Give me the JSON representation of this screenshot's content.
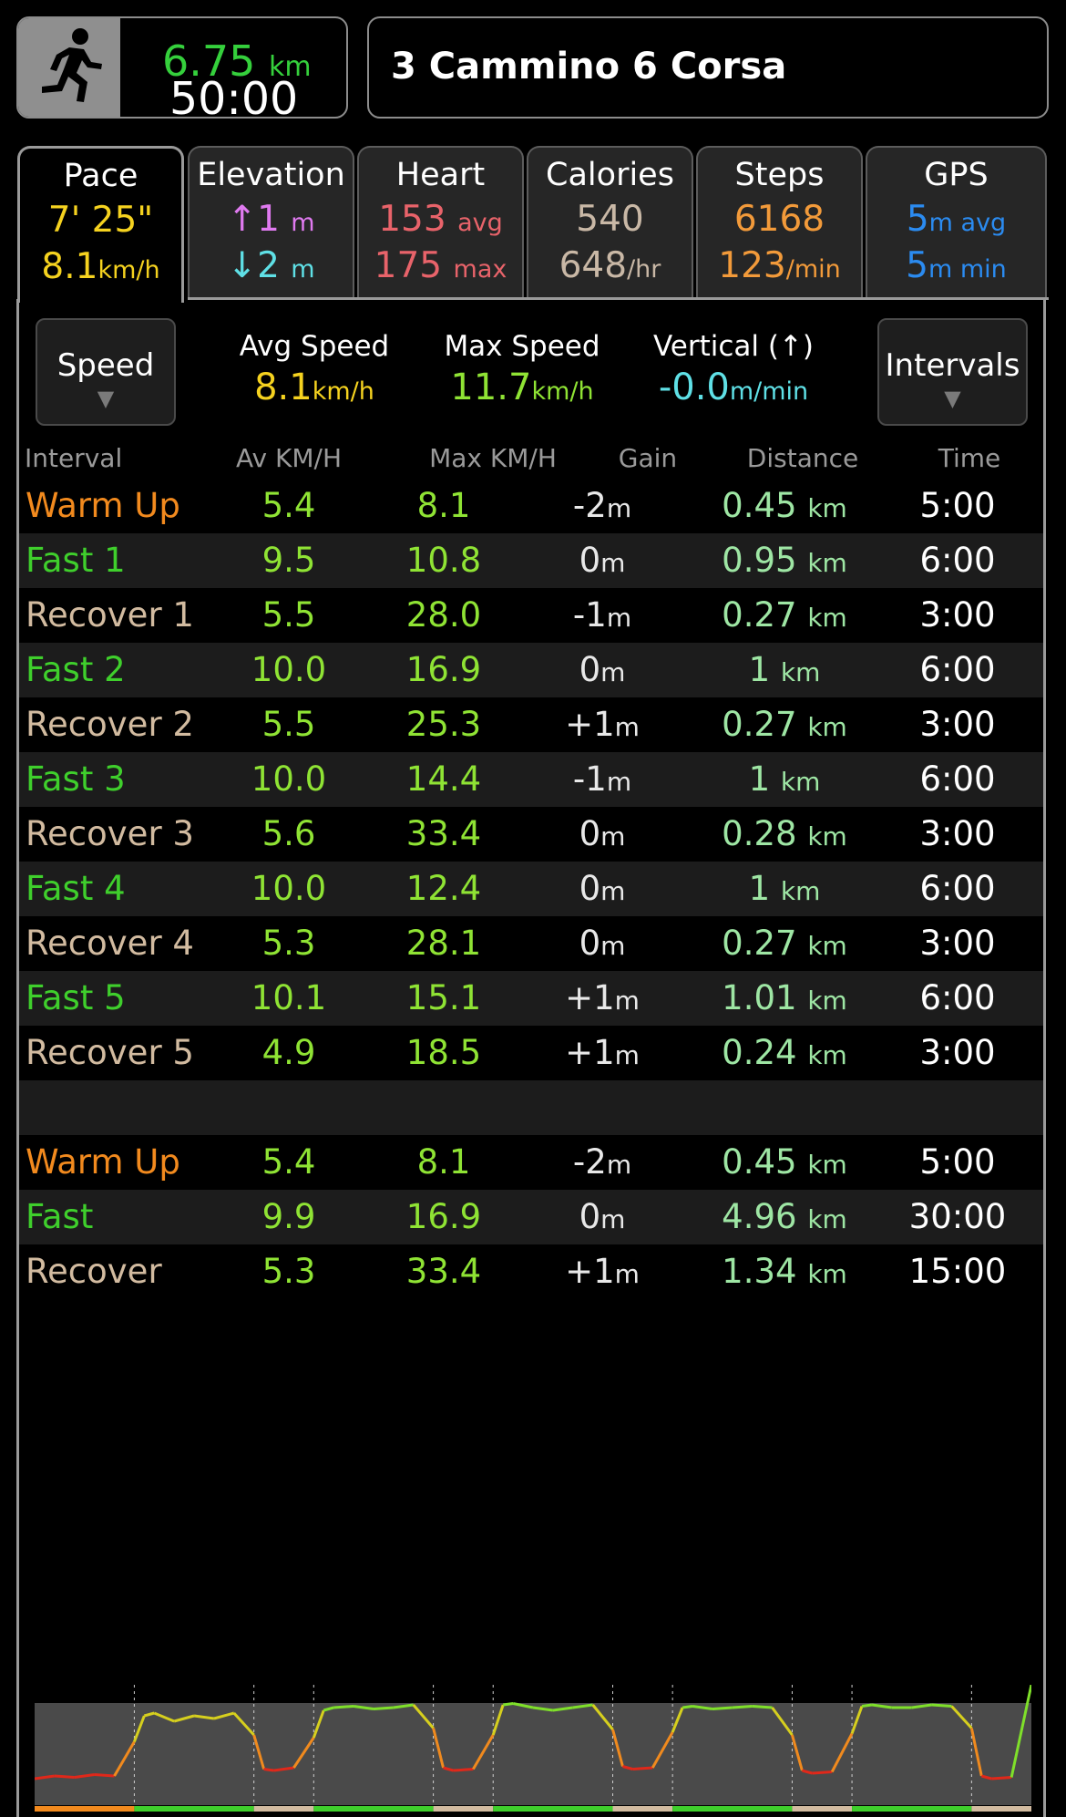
{
  "header": {
    "activity_icon": "runner-icon",
    "distance_value": "6.75",
    "distance_unit": "km",
    "duration": "50:00",
    "workout_name": "3 Cammino 6 Corsa"
  },
  "tabs": [
    {
      "title": "Pace",
      "line1": "7' 25\"",
      "line2_value": "8.1",
      "line2_unit": "km/h"
    },
    {
      "title": "Elevation",
      "line1_value": "↑1",
      "line1_unit": "m",
      "line2_value": "↓2",
      "line2_unit": "m"
    },
    {
      "title": "Heart",
      "line1_value": "153",
      "line1_unit": "avg",
      "line2_value": "175",
      "line2_unit": "max"
    },
    {
      "title": "Calories",
      "line1": "540",
      "line2_value": "648",
      "line2_unit": "/hr"
    },
    {
      "title": "Steps",
      "line1": "6168",
      "line2_value": "123",
      "line2_unit": "/min"
    },
    {
      "title": "GPS",
      "line1_value": "5",
      "line1_unit": "m avg",
      "line2_value": "5",
      "line2_unit": "m min"
    }
  ],
  "selected_tab": "Pace",
  "controls": {
    "left_button": "Speed",
    "right_button": "Intervals",
    "dropdown_arrow": "▼",
    "stats": [
      {
        "label": "Avg Speed",
        "value": "8.1",
        "unit": "km/h"
      },
      {
        "label": "Max Speed",
        "value": "11.7",
        "unit": "km/h"
      },
      {
        "label": "Vertical (↑)",
        "value": "-0.0",
        "unit": "m/min"
      }
    ]
  },
  "table": {
    "columns": [
      "Interval",
      "Av KM/H",
      "Max KM/H",
      "Gain",
      "Distance",
      "Time"
    ],
    "rows": [
      {
        "name": "Warm Up",
        "kind": "warm",
        "av": "5.4",
        "max": "8.1",
        "gain": "-2",
        "gain_unit": "m",
        "dist": "0.45",
        "dist_unit": "km",
        "time": "5:00"
      },
      {
        "name": "Fast 1",
        "kind": "fast",
        "av": "9.5",
        "max": "10.8",
        "gain": "0",
        "gain_unit": "m",
        "dist": "0.95",
        "dist_unit": "km",
        "time": "6:00"
      },
      {
        "name": "Recover 1",
        "kind": "rec",
        "av": "5.5",
        "max": "28.0",
        "gain": "-1",
        "gain_unit": "m",
        "dist": "0.27",
        "dist_unit": "km",
        "time": "3:00"
      },
      {
        "name": "Fast 2",
        "kind": "fast",
        "av": "10.0",
        "max": "16.9",
        "gain": "0",
        "gain_unit": "m",
        "dist": "1",
        "dist_unit": "km",
        "time": "6:00"
      },
      {
        "name": "Recover 2",
        "kind": "rec",
        "av": "5.5",
        "max": "25.3",
        "gain": "+1",
        "gain_unit": "m",
        "dist": "0.27",
        "dist_unit": "km",
        "time": "3:00"
      },
      {
        "name": "Fast 3",
        "kind": "fast",
        "av": "10.0",
        "max": "14.4",
        "gain": "-1",
        "gain_unit": "m",
        "dist": "1",
        "dist_unit": "km",
        "time": "6:00"
      },
      {
        "name": "Recover 3",
        "kind": "rec",
        "av": "5.6",
        "max": "33.4",
        "gain": "0",
        "gain_unit": "m",
        "dist": "0.28",
        "dist_unit": "km",
        "time": "3:00"
      },
      {
        "name": "Fast 4",
        "kind": "fast",
        "av": "10.0",
        "max": "12.4",
        "gain": "0",
        "gain_unit": "m",
        "dist": "1",
        "dist_unit": "km",
        "time": "6:00"
      },
      {
        "name": "Recover 4",
        "kind": "rec",
        "av": "5.3",
        "max": "28.1",
        "gain": "0",
        "gain_unit": "m",
        "dist": "0.27",
        "dist_unit": "km",
        "time": "3:00"
      },
      {
        "name": "Fast 5",
        "kind": "fast",
        "av": "10.1",
        "max": "15.1",
        "gain": "+1",
        "gain_unit": "m",
        "dist": "1.01",
        "dist_unit": "km",
        "time": "6:00"
      },
      {
        "name": "Recover 5",
        "kind": "rec",
        "av": "4.9",
        "max": "18.5",
        "gain": "+1",
        "gain_unit": "m",
        "dist": "0.24",
        "dist_unit": "km",
        "time": "3:00"
      }
    ],
    "summary_rows": [
      {
        "name": "Warm Up",
        "kind": "warm",
        "av": "5.4",
        "max": "8.1",
        "gain": "-2",
        "gain_unit": "m",
        "dist": "0.45",
        "dist_unit": "km",
        "time": "5:00"
      },
      {
        "name": "Fast",
        "kind": "fast",
        "av": "9.9",
        "max": "16.9",
        "gain": "0",
        "gain_unit": "m",
        "dist": "4.96",
        "dist_unit": "km",
        "time": "30:00"
      },
      {
        "name": "Recover",
        "kind": "rec",
        "av": "5.3",
        "max": "33.4",
        "gain": "+1",
        "gain_unit": "m",
        "dist": "1.34",
        "dist_unit": "km",
        "time": "15:00"
      }
    ]
  },
  "colors": {
    "pace": "#f5d21f",
    "distance": "#35d03c",
    "elev_up": "#e07af0",
    "elev_down": "#5fe0e6",
    "heart": "#e8636a",
    "calories": "#c9b8a6",
    "steps": "#f29a3a",
    "gps": "#2b8bf0",
    "max_speed": "#8fe334",
    "vertical": "#5fe0e6"
  },
  "chart_data": {
    "type": "line",
    "x_unit": "min",
    "xlim": [
      0,
      50
    ],
    "intervals": [
      {
        "kind": "warm",
        "start": 0,
        "end": 5
      },
      {
        "kind": "fast",
        "start": 5,
        "end": 11
      },
      {
        "kind": "rec",
        "start": 11,
        "end": 14
      },
      {
        "kind": "fast",
        "start": 14,
        "end": 20
      },
      {
        "kind": "rec",
        "start": 20,
        "end": 23
      },
      {
        "kind": "fast",
        "start": 23,
        "end": 29
      },
      {
        "kind": "rec",
        "start": 29,
        "end": 32
      },
      {
        "kind": "fast",
        "start": 32,
        "end": 38
      },
      {
        "kind": "rec",
        "start": 38,
        "end": 41
      },
      {
        "kind": "fast",
        "start": 41,
        "end": 47
      },
      {
        "kind": "rec",
        "start": 47,
        "end": 50
      }
    ],
    "speed_series": {
      "x": [
        0,
        1,
        2,
        3,
        4,
        5,
        5.5,
        6,
        7,
        8,
        9,
        10,
        11,
        11.5,
        12,
        13,
        14,
        14.5,
        15,
        16,
        17,
        18,
        19,
        20,
        20.5,
        21,
        22,
        23,
        23.5,
        24,
        25,
        26,
        27,
        28,
        29,
        29.5,
        30,
        31,
        32,
        32.5,
        33,
        34,
        35,
        36,
        37,
        38,
        38.5,
        39,
        40,
        41,
        41.5,
        42,
        43,
        44,
        45,
        46,
        47,
        47.5,
        48,
        49,
        50
      ],
      "y": [
        4.8,
        5.0,
        4.9,
        5.1,
        5.0,
        7.5,
        9.4,
        9.6,
        9.0,
        9.4,
        9.2,
        9.6,
        8.0,
        5.5,
        5.4,
        5.6,
        7.8,
        9.8,
        10.0,
        10.1,
        9.9,
        10.0,
        10.2,
        8.5,
        5.6,
        5.4,
        5.5,
        8.0,
        10.2,
        10.3,
        10.0,
        9.8,
        10.0,
        10.2,
        8.4,
        5.7,
        5.5,
        5.6,
        8.2,
        10.0,
        10.1,
        9.9,
        10.0,
        10.1,
        10.0,
        8.0,
        5.4,
        5.2,
        5.3,
        8.1,
        10.1,
        10.2,
        10.0,
        10.0,
        10.2,
        10.1,
        8.5,
        5.0,
        4.8,
        4.9
      ]
    },
    "elevation_profile": "grey"
  }
}
